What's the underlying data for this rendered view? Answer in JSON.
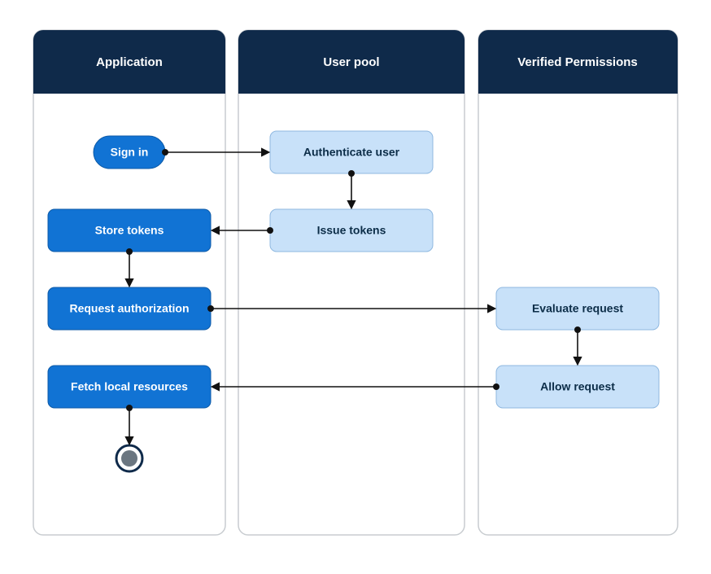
{
  "lanes": {
    "application": "Application",
    "user_pool": "User pool",
    "verified_permissions": "Verified Permissions"
  },
  "nodes": {
    "sign_in": "Sign in",
    "authenticate_user": "Authenticate user",
    "issue_tokens": "Issue tokens",
    "store_tokens": "Store tokens",
    "request_authorization": "Request authorization",
    "evaluate_request": "Evaluate request",
    "allow_request": "Allow request",
    "fetch_local_resources": "Fetch local resources"
  },
  "chart_data": {
    "type": "diagram",
    "diagram_kind": "activity-swimlane",
    "lanes": [
      "Application",
      "User pool",
      "Verified Permissions"
    ],
    "nodes": [
      {
        "id": "sign_in",
        "label": "Sign in",
        "lane": "Application",
        "kind": "start-action",
        "style": "dark-pill"
      },
      {
        "id": "authenticate_user",
        "label": "Authenticate user",
        "lane": "User pool",
        "kind": "action",
        "style": "light-box"
      },
      {
        "id": "issue_tokens",
        "label": "Issue tokens",
        "lane": "User pool",
        "kind": "action",
        "style": "light-box"
      },
      {
        "id": "store_tokens",
        "label": "Store tokens",
        "lane": "Application",
        "kind": "action",
        "style": "dark-box"
      },
      {
        "id": "request_authorization",
        "label": "Request authorization",
        "lane": "Application",
        "kind": "action",
        "style": "dark-box"
      },
      {
        "id": "evaluate_request",
        "label": "Evaluate request",
        "lane": "Verified Permissions",
        "kind": "action",
        "style": "light-box"
      },
      {
        "id": "allow_request",
        "label": "Allow request",
        "lane": "Verified Permissions",
        "kind": "action",
        "style": "light-box"
      },
      {
        "id": "fetch_local_resources",
        "label": "Fetch local resources",
        "lane": "Application",
        "kind": "action",
        "style": "dark-box"
      },
      {
        "id": "final",
        "label": "",
        "lane": "Application",
        "kind": "final"
      }
    ],
    "edges": [
      {
        "from": "sign_in",
        "to": "authenticate_user"
      },
      {
        "from": "authenticate_user",
        "to": "issue_tokens"
      },
      {
        "from": "issue_tokens",
        "to": "store_tokens"
      },
      {
        "from": "store_tokens",
        "to": "request_authorization"
      },
      {
        "from": "request_authorization",
        "to": "evaluate_request"
      },
      {
        "from": "evaluate_request",
        "to": "allow_request"
      },
      {
        "from": "allow_request",
        "to": "fetch_local_resources"
      },
      {
        "from": "fetch_local_resources",
        "to": "final"
      }
    ]
  },
  "colors": {
    "lane_header": "#0f2a4a",
    "dark_box_fill": "#1173d4",
    "light_box_fill": "#c8e1f9",
    "lane_border": "#c8ccd0"
  }
}
